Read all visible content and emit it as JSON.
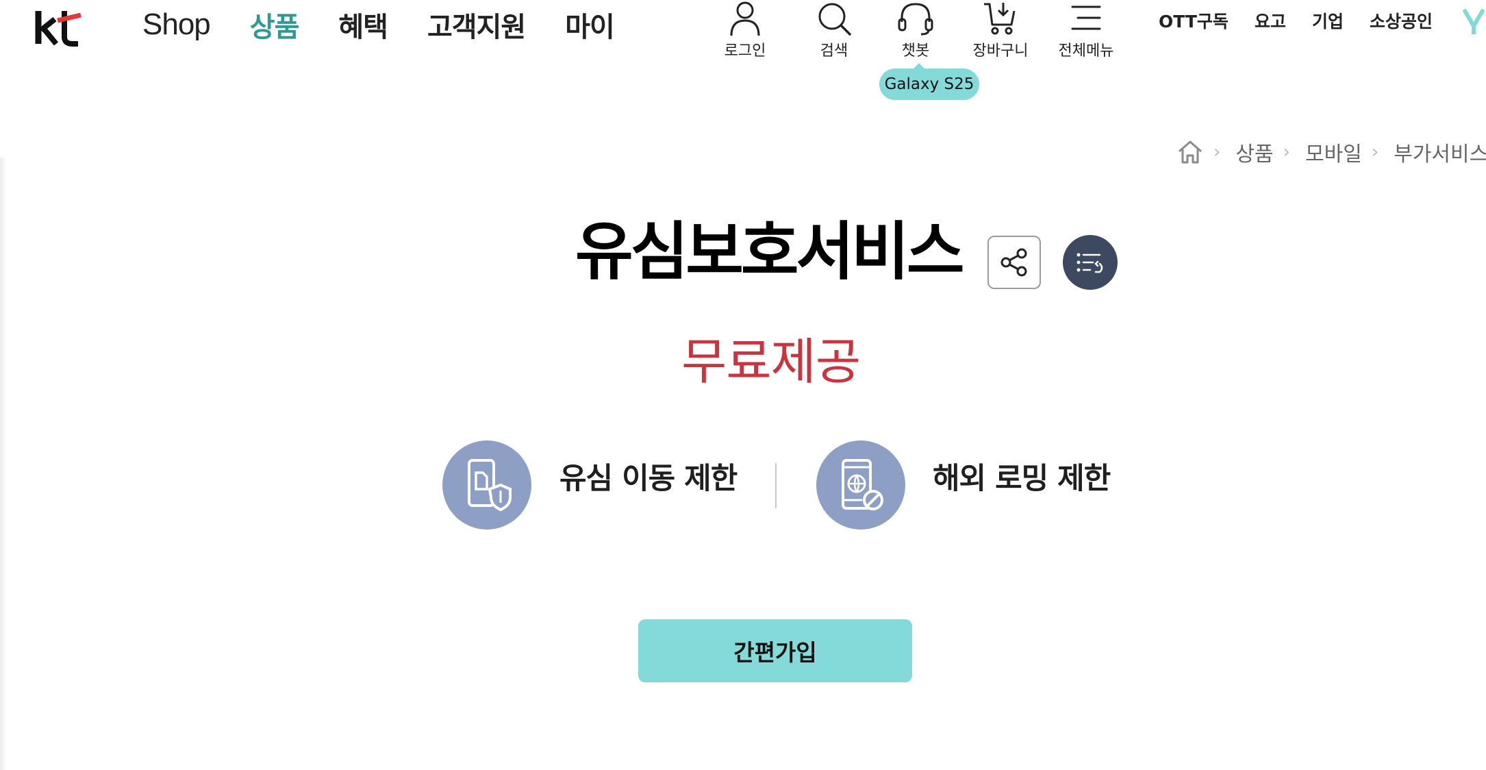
{
  "header": {
    "logo_text": "kt",
    "main_nav": [
      {
        "label": "Shop",
        "active": false
      },
      {
        "label": "상품",
        "active": true
      },
      {
        "label": "혜택",
        "active": false
      },
      {
        "label": "고객지원",
        "active": false
      },
      {
        "label": "마이",
        "active": false
      }
    ],
    "utilities": [
      {
        "label": "로그인",
        "icon": "person-icon"
      },
      {
        "label": "검색",
        "icon": "search-icon"
      },
      {
        "label": "챗봇",
        "icon": "headset-icon"
      },
      {
        "label": "장바구니",
        "icon": "cart-icon"
      },
      {
        "label": "전체메뉴",
        "icon": "menu-icon"
      }
    ],
    "tooltip": "Galaxy S25",
    "sub_nav": [
      "OTT구독",
      "요고",
      "기업",
      "소상공인"
    ]
  },
  "breadcrumb": [
    "상품",
    "모바일",
    "부가서비스"
  ],
  "product": {
    "title": "유심보호서비스",
    "price": "무료제공",
    "features": [
      {
        "label": "유심 이동 제한",
        "icon": "sim-shield-icon"
      },
      {
        "label": "해외 로밍 제한",
        "icon": "roaming-block-icon"
      }
    ],
    "join_button": "간편가입"
  },
  "colors": {
    "accent_teal": "#2f9a94",
    "tooltip_bg": "#84d9d9",
    "button_bg": "#84d9d9",
    "price_red": "#c9343f",
    "feature_icon_bg": "#8d9fc4",
    "list_button_bg": "#3d4961"
  }
}
